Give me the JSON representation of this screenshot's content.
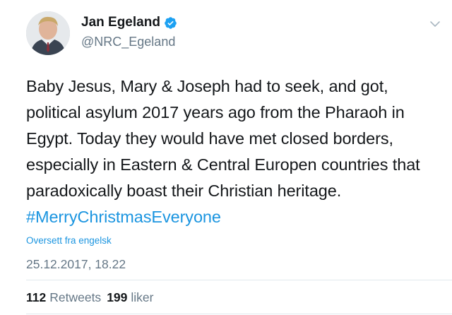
{
  "user": {
    "display_name": "Jan Egeland",
    "handle": "@NRC_Egeland"
  },
  "tweet": {
    "lines": [
      "Baby Jesus, Mary & Joseph had to seek, and got,",
      "political asylum 2017 years ago from the Pharaoh in",
      "Egypt. Today they would have met closed borders,",
      "especially in Eastern & Central Europen countries that",
      "paradoxically boast their Christian heritage."
    ],
    "hashtag": "#MerryChristmasEveryone",
    "translate_label": "Oversett fra engelsk",
    "timestamp": "25.12.2017, 18.22"
  },
  "stats": {
    "retweets_count": "112",
    "retweets_label": "Retweets",
    "likes_count": "199",
    "likes_label": "liker"
  },
  "colors": {
    "link": "#1b95e0",
    "secondary_text": "#657786",
    "primary_text": "#14171a",
    "verified_badge": "#1da1f2"
  },
  "icons": [
    "verified-badge-icon",
    "chevron-down-icon"
  ]
}
